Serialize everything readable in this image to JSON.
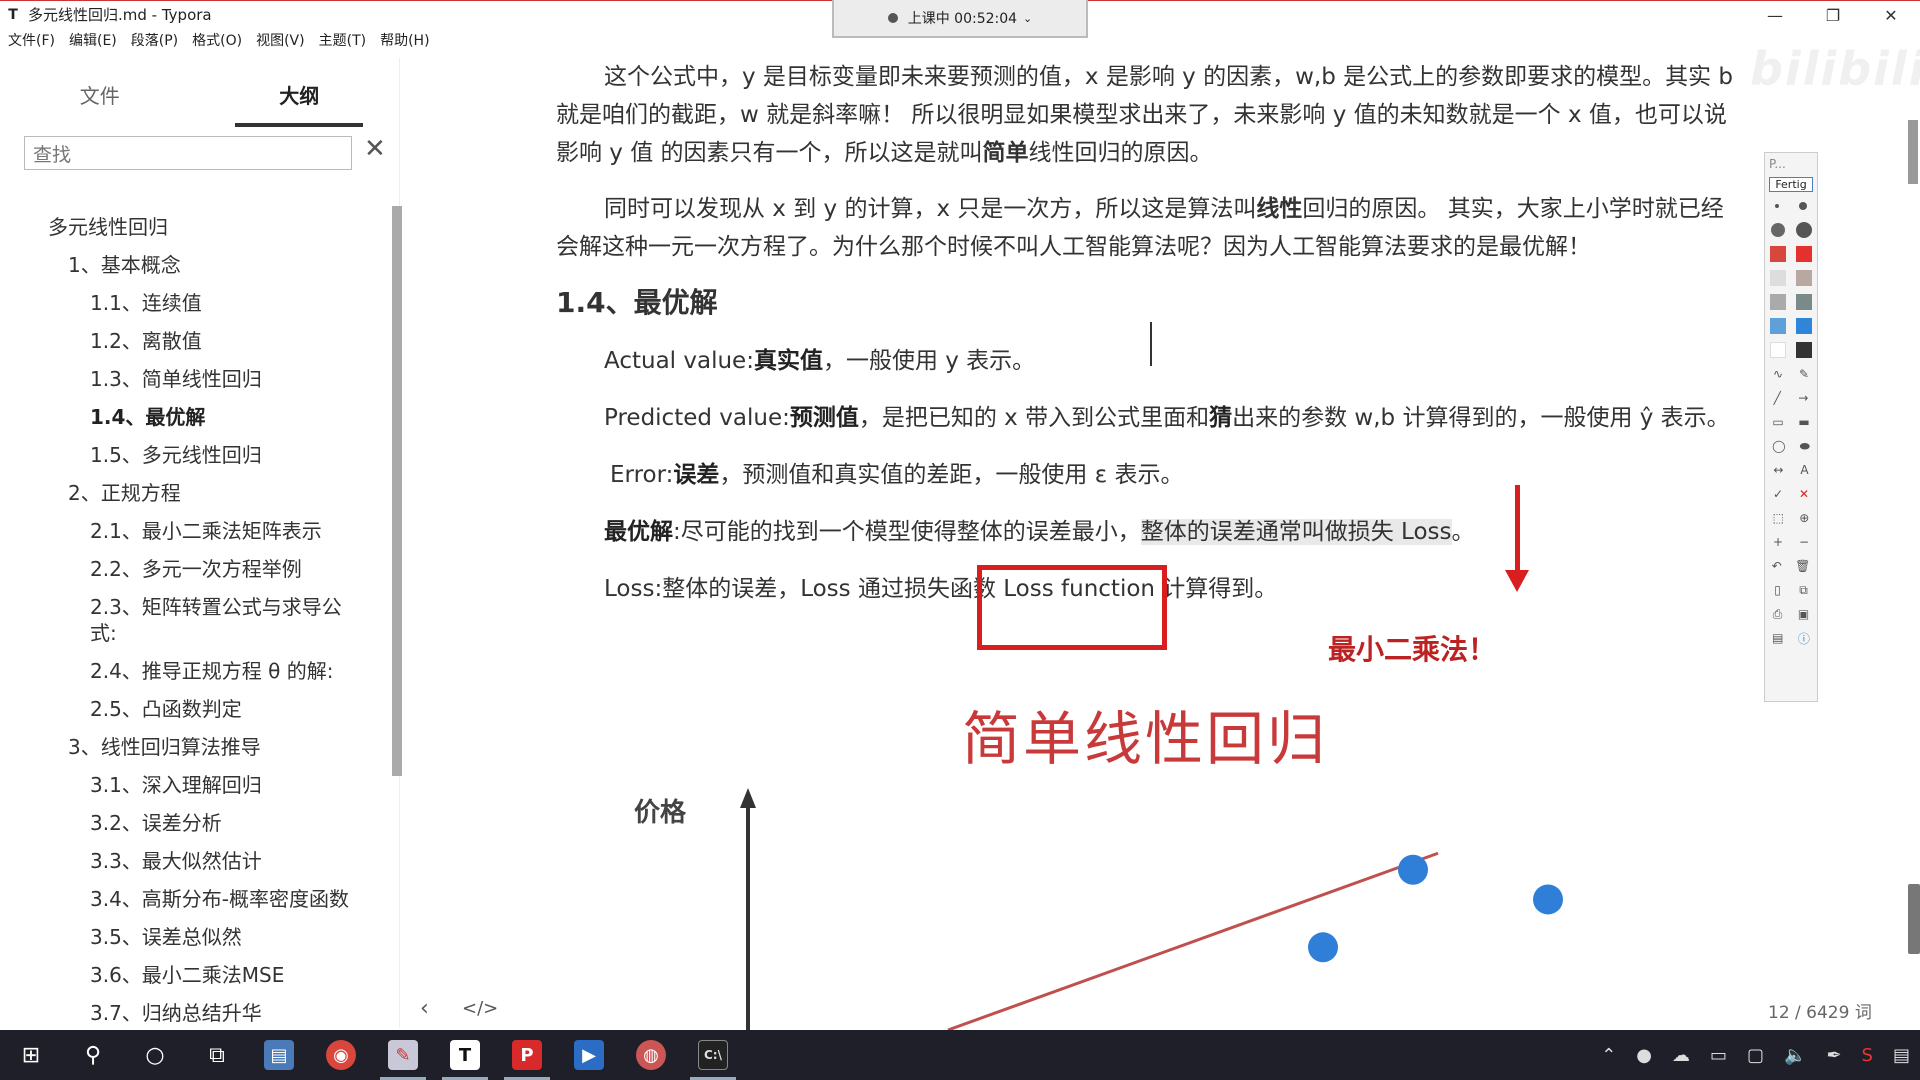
{
  "window": {
    "icon": "T",
    "title": "多元线性回归.md - Typora",
    "minimize": "—",
    "maximize": "❐",
    "close": "✕"
  },
  "recording": {
    "label": "上课中 00:52:04"
  },
  "menu": [
    "文件(F)",
    "编辑(E)",
    "段落(P)",
    "格式(O)",
    "视图(V)",
    "主题(T)",
    "帮助(H)"
  ],
  "sidebar": {
    "tabs": [
      "文件",
      "大纲"
    ],
    "search_placeholder": "查找",
    "outline": [
      {
        "label": "多元线性回归",
        "level": 0
      },
      {
        "label": "1、基本概念",
        "level": 1
      },
      {
        "label": "1.1、连续值",
        "level": 2
      },
      {
        "label": "1.2、离散值",
        "level": 2
      },
      {
        "label": "1.3、简单线性回归",
        "level": 2
      },
      {
        "label": "1.4、最优解",
        "level": 2,
        "active": true
      },
      {
        "label": "1.5、多元线性回归",
        "level": 2
      },
      {
        "label": "2、正规方程",
        "level": 1
      },
      {
        "label": "2.1、最小二乘法矩阵表示",
        "level": 2
      },
      {
        "label": "2.2、多元一次方程举例",
        "level": 2
      },
      {
        "label": "2.3、矩阵转置公式与求导公式:",
        "level": 2,
        "wrap": true
      },
      {
        "label": "2.4、推导正规方程 θ 的解:",
        "level": 2
      },
      {
        "label": "2.5、凸函数判定",
        "level": 2
      },
      {
        "label": "3、线性回归算法推导",
        "level": 1
      },
      {
        "label": "3.1、深入理解回归",
        "level": 2
      },
      {
        "label": "3.2、误差分析",
        "level": 2
      },
      {
        "label": "3.3、最大似然估计",
        "level": 2
      },
      {
        "label": "3.4、高斯分布-概率密度函数",
        "level": 2
      },
      {
        "label": "3.5、误差总似然",
        "level": 2
      },
      {
        "label": "3.6、最小二乘法MSE",
        "level": 2
      },
      {
        "label": "3.7、归纳总结升华",
        "level": 2
      }
    ]
  },
  "content": {
    "para1_a": "这个公式中，y 是目标变量即未来要预测的值，x 是影响 y 的因素，w,b 是公式上的参数即要求的模型。其实 b 就是咱们的截距，w 就是斜率嘛！ 所以很明显如果模型求出来了，未来影响 y 值的未知数就是一个 x 值，也可以说影响 y 值 的因素只有一个，所以这是就叫",
    "para1_bold": "简单",
    "para1_b": "线性回归的原因。",
    "para2_a": "同时可以发现从 x 到 y 的计算，x 只是一次方，所以这是算法叫",
    "para2_bold": "线性",
    "para2_b": "回归的原因。 其实，大家上小学时就已经会解这种一元一次方程了。为什么那个时候不叫人工智能算法呢？因为人工智能算法要求的是最优解！",
    "heading": "1.4、最优解",
    "actual_a": "Actual value:",
    "actual_bold": "真实值",
    "actual_b": "，一般使用 y 表示。",
    "pred_a": "Predicted value:",
    "pred_bold": "预测值",
    "pred_b": "，是把已知的 x 带入到公式里面和",
    "pred_bold2": "猜",
    "pred_c": "出来的参数 w,b 计算得到的，一般使用 ŷ 表示。",
    "err_a": "Error:",
    "err_bold": "误差",
    "err_b": "，预测值和真实值的差距，一般使用 ε 表示。",
    "opt_bold": "最优解",
    "opt_a": ":尽可能的找到一个模型使得整体的误差最小，",
    "opt_hl": "整体的误差通常叫做损失 Loss",
    "opt_b": "。",
    "loss_line": "Loss:整体的误差，Loss 通过损失函数 Loss function 计算得到。"
  },
  "annotations": {
    "least_squares": "最小二乘法！",
    "color": "#d81e1e"
  },
  "figure": {
    "title": "简单线性回归",
    "ylabel": "价格"
  },
  "chart_data": {
    "type": "scatter",
    "title": "简单线性回归",
    "xlabel": "",
    "ylabel": "价格",
    "points": [
      {
        "x": 0.55,
        "y": 0.38
      },
      {
        "x": 0.73,
        "y": 0.85
      },
      {
        "x": 1.0,
        "y": 0.67
      }
    ],
    "fit_line": {
      "x": [
        0.0,
        1.2
      ],
      "y": [
        0.0,
        0.95
      ]
    },
    "point_color": "#2f7fd8",
    "line_color": "#c0504d"
  },
  "footer": {
    "prev": "‹",
    "source": "</>",
    "wordcount": "12 / 6429 词"
  },
  "palette": {
    "header": "P...",
    "done": "Fertig"
  },
  "watermark": "bilibili"
}
